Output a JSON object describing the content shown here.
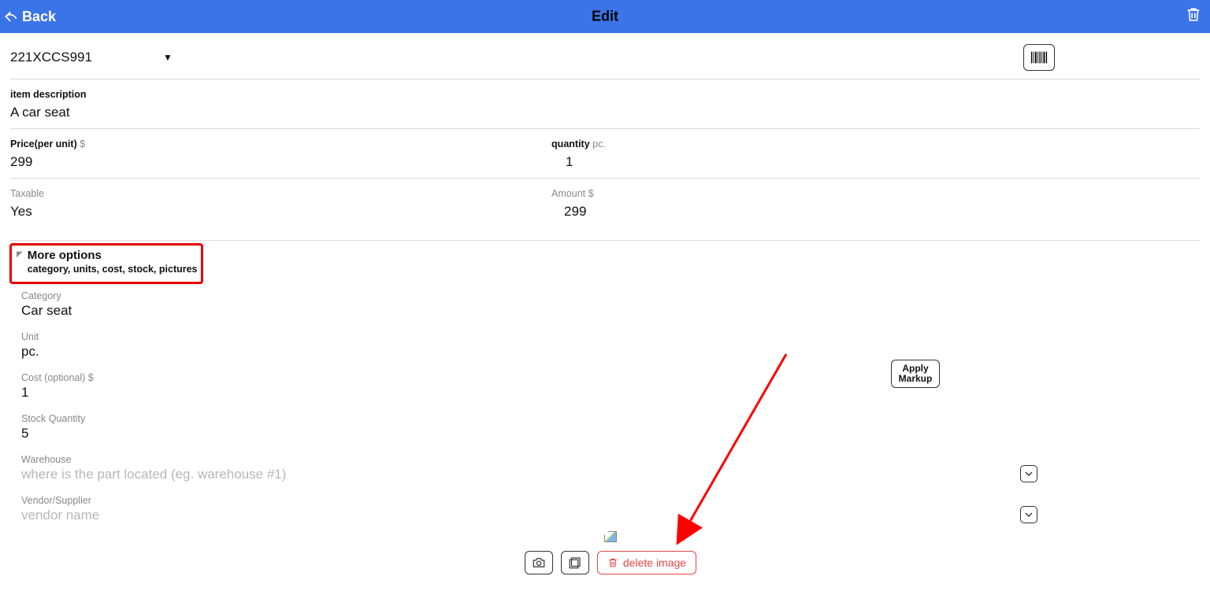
{
  "header": {
    "back_label": "Back",
    "title": "Edit"
  },
  "sku": {
    "value": "221XCCS991"
  },
  "description": {
    "label": "item description",
    "value": "A car seat"
  },
  "price": {
    "label": "Price(per unit)",
    "unit": "$",
    "value": "299"
  },
  "quantity": {
    "label": "quantity",
    "unit": "pc.",
    "value": "1"
  },
  "taxable": {
    "label": "Taxable",
    "value": "Yes"
  },
  "amount": {
    "label": "Amount",
    "unit": "$",
    "value": "299"
  },
  "more": {
    "title": "More options",
    "subtitle": "category, units, cost, stock, pictures"
  },
  "category": {
    "label": "Category",
    "value": "Car seat"
  },
  "unit_field": {
    "label": "Unit",
    "value": "pc."
  },
  "cost": {
    "label": "Cost (optional)",
    "unit": "$",
    "value": "1"
  },
  "apply_markup_label": "Apply Markup",
  "stock": {
    "label": "Stock Quantity",
    "value": "5"
  },
  "warehouse": {
    "label": "Warehouse",
    "placeholder": "where is the part located (eg. warehouse #1)",
    "value": ""
  },
  "vendor": {
    "label": "Vendor/Supplier",
    "placeholder": "vendor name",
    "value": ""
  },
  "delete_image_label": "delete image",
  "annotation": {
    "highlight_color": "#e60000",
    "arrow_color": "#ff0000"
  }
}
